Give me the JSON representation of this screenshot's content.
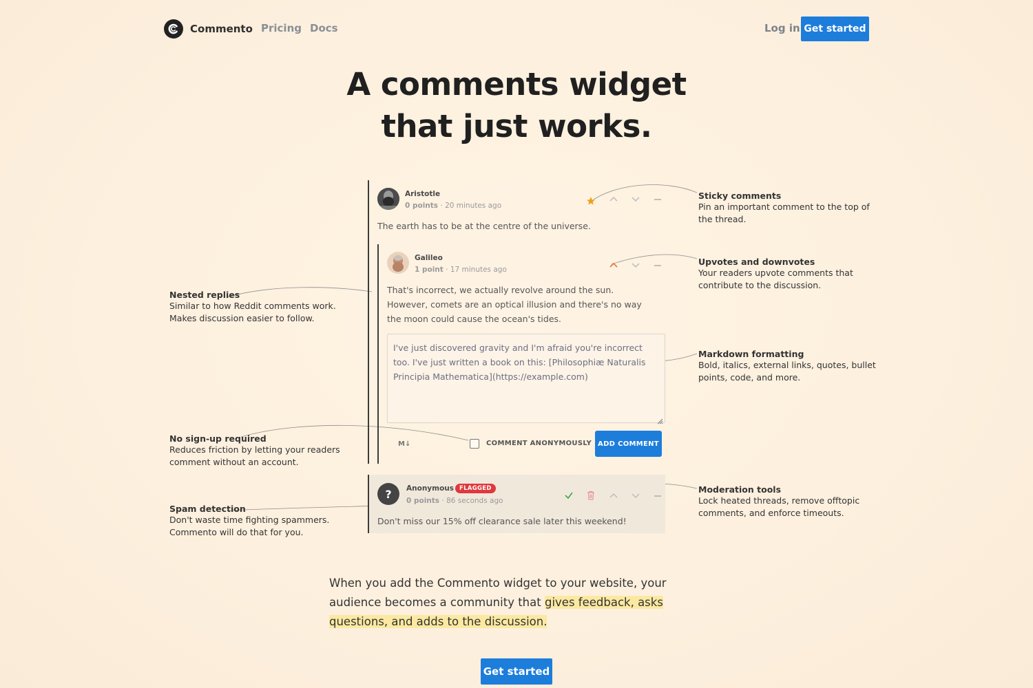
{
  "nav": {
    "brand": "Commento",
    "links": [
      {
        "label": "Pricing"
      },
      {
        "label": "Docs"
      }
    ],
    "login": "Log in",
    "cta": "Get started"
  },
  "hero": {
    "line1": "A comments widget",
    "line2": "that just works."
  },
  "widget": {
    "comments": [
      {
        "author": "Aristotle",
        "points": "0 points",
        "time": "20 minutes ago",
        "body": "The earth has to be at the centre of the universe.",
        "sticky": true
      },
      {
        "author": "Galileo",
        "points": "1 point",
        "time": "17 minutes ago",
        "body": "That's incorrect, we actually revolve around the sun. However, comets are an optical illusion and there's no way the moon could cause the ocean's tides.",
        "upvoted": true
      }
    ],
    "reply_box": {
      "value": "I've just discovered gravity and I'm afraid you're incorrect too. I've just written a book on this: [Philosophiæ Naturalis Principia Mathematica](https://example.com)",
      "markdown_label": "M↓",
      "anonymous_label": "COMMENT ANONYMOUSLY",
      "submit_label": "ADD COMMENT"
    },
    "flagged_comment": {
      "author": "Anonymous",
      "badge": "FLAGGED",
      "points": "0 points",
      "time": "86 seconds ago",
      "body": "Don't miss our 15% off clearance sale later this weekend!"
    }
  },
  "features": {
    "sticky": {
      "title": "Sticky comments",
      "desc": [
        "Pin an important comment to the top of",
        "the thread."
      ]
    },
    "votes": {
      "title": "Upvotes and downvotes",
      "desc": [
        "Your readers upvote comments that",
        "contribute to the discussion."
      ]
    },
    "markdown": {
      "title": "Markdown formatting",
      "desc": [
        "Bold, italics, external links, quotes, bullet",
        "points, code, and more."
      ]
    },
    "moderation": {
      "title": "Moderation tools",
      "desc": [
        "Lock heated threads, remove offtopic",
        "comments, and enforce timeouts."
      ]
    },
    "nested": {
      "title": "Nested replies",
      "desc": [
        "Similar to how Reddit comments work.",
        "Makes discussion easier to follow."
      ]
    },
    "nosignup": {
      "title": "No sign-up required",
      "desc": [
        "Reduces friction by letting your readers",
        "comment without an account."
      ]
    },
    "spam": {
      "title": "Spam detection",
      "desc": [
        "Don't waste time fighting spammers.",
        "Commento will do that for you."
      ]
    }
  },
  "pitch": {
    "lead": "When you add the Commento widget to your website, your audience becomes a community that ",
    "highlight": "gives feedback, asks questions, and adds to the discussion."
  },
  "bottom_cta": "Get started",
  "colors": {
    "accent": "#1d7ddb",
    "background": "#fdf0de",
    "flag": "#e0383e",
    "highlight": "#fbe9a1",
    "sticky_star": "#f0a01a",
    "upvote_active": "#e8762c",
    "approve_check": "#3aa64a",
    "delete_icon": "#e4868a"
  }
}
